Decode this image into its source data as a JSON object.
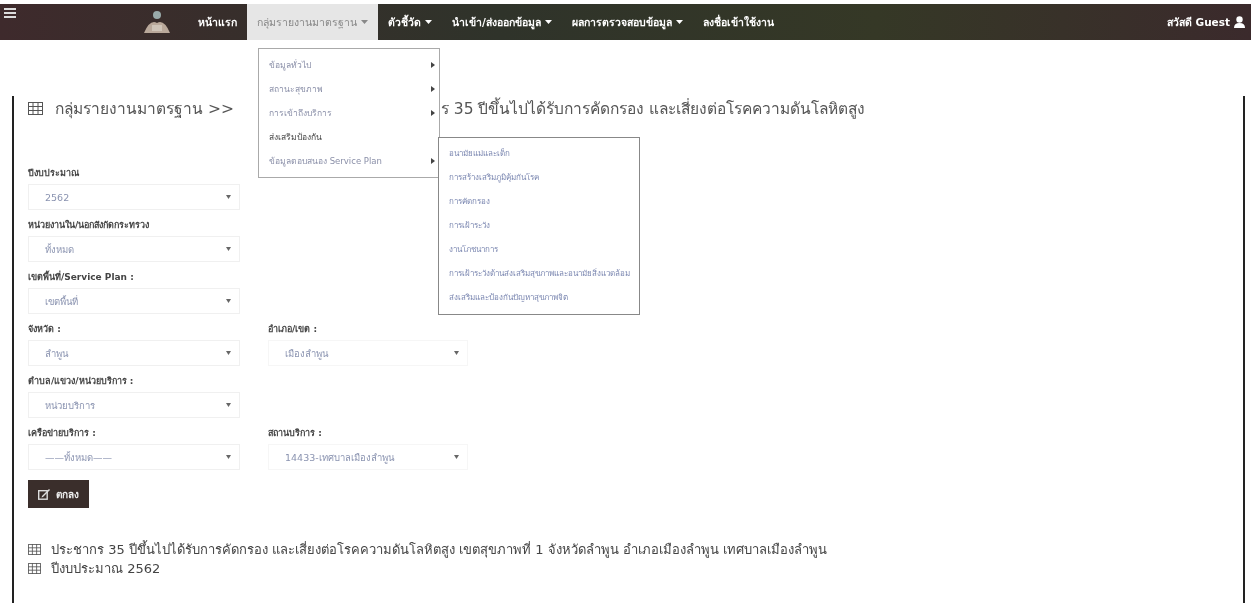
{
  "navbar": {
    "items": [
      {
        "label": "หน้าแรก",
        "dropdown": false,
        "selected": false
      },
      {
        "label": "กลุ่มรายงานมาตรฐาน",
        "dropdown": true,
        "selected": true
      },
      {
        "label": "ตัวชี้วัด",
        "dropdown": true,
        "selected": false
      },
      {
        "label": "นำเข้า/ส่งออกข้อมูล",
        "dropdown": true,
        "selected": false
      },
      {
        "label": "ผลการตรวจสอบข้อมูล",
        "dropdown": true,
        "selected": false
      },
      {
        "label": "ลงชื่อเข้าใช้งาน",
        "dropdown": false,
        "selected": false
      }
    ],
    "user": "สวัสดี Guest"
  },
  "menu": {
    "items": [
      {
        "label": "ข้อมูลทั่วไป",
        "submenu": true,
        "selected": false
      },
      {
        "label": "สถานะสุขภาพ",
        "submenu": true,
        "selected": false
      },
      {
        "label": "การเข้าถึงบริการ",
        "submenu": true,
        "selected": false
      },
      {
        "label": "ส่งเสริมป้องกัน",
        "submenu": false,
        "selected": true
      },
      {
        "label": "ข้อมูลตอบสนอง Service Plan",
        "submenu": true,
        "selected": false
      }
    ],
    "submenu": [
      "อนามัยแม่และเด็ก",
      "การสร้างเสริมภูมิคุ้มกันโรค",
      "การคัดกรอง",
      "การเฝ้าระวัง",
      "งานโภชนาการ",
      "การเฝ้าระวังด้านส่งเสริมสุขภาพและอนามัยสิ่งแวดล้อม",
      "ส่งเสริมและป้องกันปัญหาสุขภาพจิต"
    ]
  },
  "title": {
    "start": "กลุ่มรายงานมาตรฐาน >>",
    "end": "ร 35 ปีขึ้นไปได้รับการคัดกรอง และเสี่ยงต่อโรคความดันโลหิตสูง"
  },
  "form": {
    "rows": [
      {
        "fields": [
          {
            "label": "ปีงบประมาณ",
            "value": "2562"
          }
        ]
      },
      {
        "fields": [
          {
            "label": "หน่วยงานใน/นอกสังกัดกระทรวง",
            "value": "ทั้งหมด"
          }
        ]
      },
      {
        "fields": [
          {
            "label": "เขตพื้นที่/Service Plan :",
            "value": "เขตพื้นที่"
          }
        ]
      },
      {
        "fields": [
          {
            "label": "จังหวัด :",
            "value": "ลำพูน"
          },
          {
            "label": "อำเภอ/เขต :",
            "value": "เมืองลำพูน"
          }
        ]
      },
      {
        "fields": [
          {
            "label": "ตำบล/แขวง/หน่วยบริการ :",
            "value": "หน่วยบริการ"
          }
        ]
      },
      {
        "fields": [
          {
            "label": "เครือข่ายบริการ :",
            "value": "——ทั้งหมด——"
          },
          {
            "label": "สถานบริการ :",
            "value": "14433-เทศบาลเมืองลำพูน"
          }
        ]
      }
    ],
    "submit": "ตกลง"
  },
  "results": [
    "ประชากร 35 ปีขึ้นไปได้รับการคัดกรอง และเสี่ยงต่อโรคความดันโลหิตสูง เขตสุขภาพที่ 1 จังหวัดลำพูน อำเภอเมืองลำพูน เทศบาลเมืองลำพูน",
    "ปีงบประมาณ 2562"
  ]
}
